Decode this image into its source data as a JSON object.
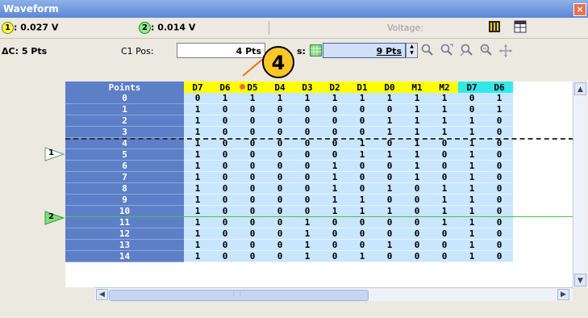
{
  "window": {
    "title": "Waveform",
    "close": "×"
  },
  "readouts": {
    "ch1_num": "1",
    "ch1_value": ": 0.027 V",
    "ch2_num": "2",
    "ch2_value": ": 0.014 V",
    "voltage_label": "Voltage:"
  },
  "cursor": {
    "delta_label": "ΔC: 5 Pts",
    "c1pos_label": "C1 Pos:",
    "c1pos_value": "4 Pts",
    "c2pos_label_fragment": "s:",
    "c2pos_value": "9 Pts"
  },
  "callout": {
    "number": "4"
  },
  "markers": [
    {
      "label": "1",
      "color": "#ffffff"
    },
    {
      "label": "2",
      "color": "#7ee07e"
    }
  ],
  "table": {
    "header_points": "Points",
    "columns": [
      "D7",
      "D6",
      "D5",
      "D4",
      "D3",
      "D2",
      "D1",
      "D0",
      "M1",
      "M2",
      "D7",
      "D6"
    ],
    "column_colors": [
      "#ffff00",
      "#ffff00",
      "#ffff00",
      "#ffff00",
      "#ffff00",
      "#ffff00",
      "#ffff00",
      "#ffff00",
      "#ffff00",
      "#ffff00",
      "#33e8e8",
      "#33e8e8"
    ],
    "rows": [
      {
        "point": "0",
        "values": [
          "0",
          "1",
          "1",
          "1",
          "1",
          "1",
          "1",
          "1",
          "1",
          "1",
          "0",
          "1"
        ]
      },
      {
        "point": "1",
        "values": [
          "1",
          "0",
          "0",
          "0",
          "0",
          "0",
          "0",
          "0",
          "1",
          "1",
          "0",
          "1"
        ]
      },
      {
        "point": "2",
        "values": [
          "1",
          "0",
          "0",
          "0",
          "0",
          "0",
          "0",
          "1",
          "1",
          "1",
          "1",
          "0"
        ]
      },
      {
        "point": "3",
        "values": [
          "1",
          "0",
          "0",
          "0",
          "0",
          "0",
          "0",
          "1",
          "1",
          "1",
          "1",
          "0"
        ]
      },
      {
        "point": "4",
        "values": [
          "1",
          "0",
          "0",
          "0",
          "0",
          "0",
          "1",
          "0",
          "1",
          "0",
          "1",
          "0"
        ]
      },
      {
        "point": "5",
        "values": [
          "1",
          "0",
          "0",
          "0",
          "0",
          "0",
          "1",
          "1",
          "1",
          "0",
          "1",
          "0"
        ]
      },
      {
        "point": "6",
        "values": [
          "1",
          "0",
          "0",
          "0",
          "0",
          "1",
          "0",
          "0",
          "1",
          "0",
          "1",
          "0"
        ]
      },
      {
        "point": "7",
        "values": [
          "1",
          "0",
          "0",
          "0",
          "0",
          "1",
          "0",
          "0",
          "1",
          "0",
          "1",
          "0"
        ]
      },
      {
        "point": "8",
        "values": [
          "1",
          "0",
          "0",
          "0",
          "0",
          "1",
          "0",
          "1",
          "0",
          "1",
          "1",
          "0"
        ]
      },
      {
        "point": "9",
        "values": [
          "1",
          "0",
          "0",
          "0",
          "0",
          "1",
          "1",
          "0",
          "0",
          "1",
          "1",
          "0"
        ]
      },
      {
        "point": "10",
        "values": [
          "1",
          "0",
          "0",
          "0",
          "0",
          "1",
          "1",
          "1",
          "0",
          "1",
          "1",
          "0"
        ]
      },
      {
        "point": "11",
        "values": [
          "1",
          "0",
          "0",
          "0",
          "1",
          "0",
          "0",
          "0",
          "0",
          "1",
          "1",
          "0"
        ]
      },
      {
        "point": "12",
        "values": [
          "1",
          "0",
          "0",
          "0",
          "1",
          "0",
          "0",
          "0",
          "0",
          "0",
          "1",
          "0"
        ]
      },
      {
        "point": "13",
        "values": [
          "1",
          "0",
          "0",
          "0",
          "1",
          "0",
          "0",
          "1",
          "0",
          "0",
          "1",
          "0"
        ]
      },
      {
        "point": "14",
        "values": [
          "1",
          "0",
          "0",
          "0",
          "1",
          "0",
          "1",
          "0",
          "0",
          "0",
          "1",
          "0"
        ]
      }
    ]
  },
  "scroll": {
    "up": "▲",
    "down": "▼",
    "left": "◀",
    "right": "▶",
    "grip": "⋮⋮"
  },
  "icons": {
    "zoom_in": "🔍",
    "waveform": "▦",
    "table": "▤",
    "zoom_region": "⊕",
    "zoom_full": "⊕",
    "zoom_out": "⊖",
    "cursor": "✧",
    "grid": "▦",
    "spin_up": "▲",
    "spin_down": "▼"
  }
}
